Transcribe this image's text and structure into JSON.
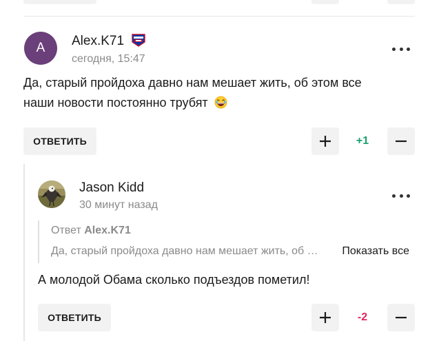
{
  "comments": [
    {
      "author": "Alex.K71",
      "avatar_letter": "A",
      "avatar_color": "#6b3f7a",
      "badge_icon": "ny-rangers-logo-icon",
      "time": "сегодня, 15:47",
      "text_line1": "Да, старый пройдоха давно нам мешает жить, об этом все",
      "text_line2": "наши новости постоянно трубят",
      "emoji_icon": "laughing-face-emoji-icon",
      "reply_label": "ОТВЕТИТЬ",
      "score": "+1",
      "score_color": "#1aa06d"
    },
    {
      "author": "Jason Kidd",
      "avatar_icon": "bird-photo-avatar-icon",
      "time": "30 минут назад",
      "quote_prefix": "Ответ",
      "quote_author": "Alex.K71",
      "quote_text": "Да, старый пройдоха давно нам мешает жить, об этом все наши новости постоянно трубят",
      "show_all_label": "Показать все",
      "text": "А молодой Обама сколько подъездов пометил!",
      "reply_label": "ОТВЕТИТЬ",
      "score": "-2",
      "score_color": "#e0245e"
    }
  ]
}
